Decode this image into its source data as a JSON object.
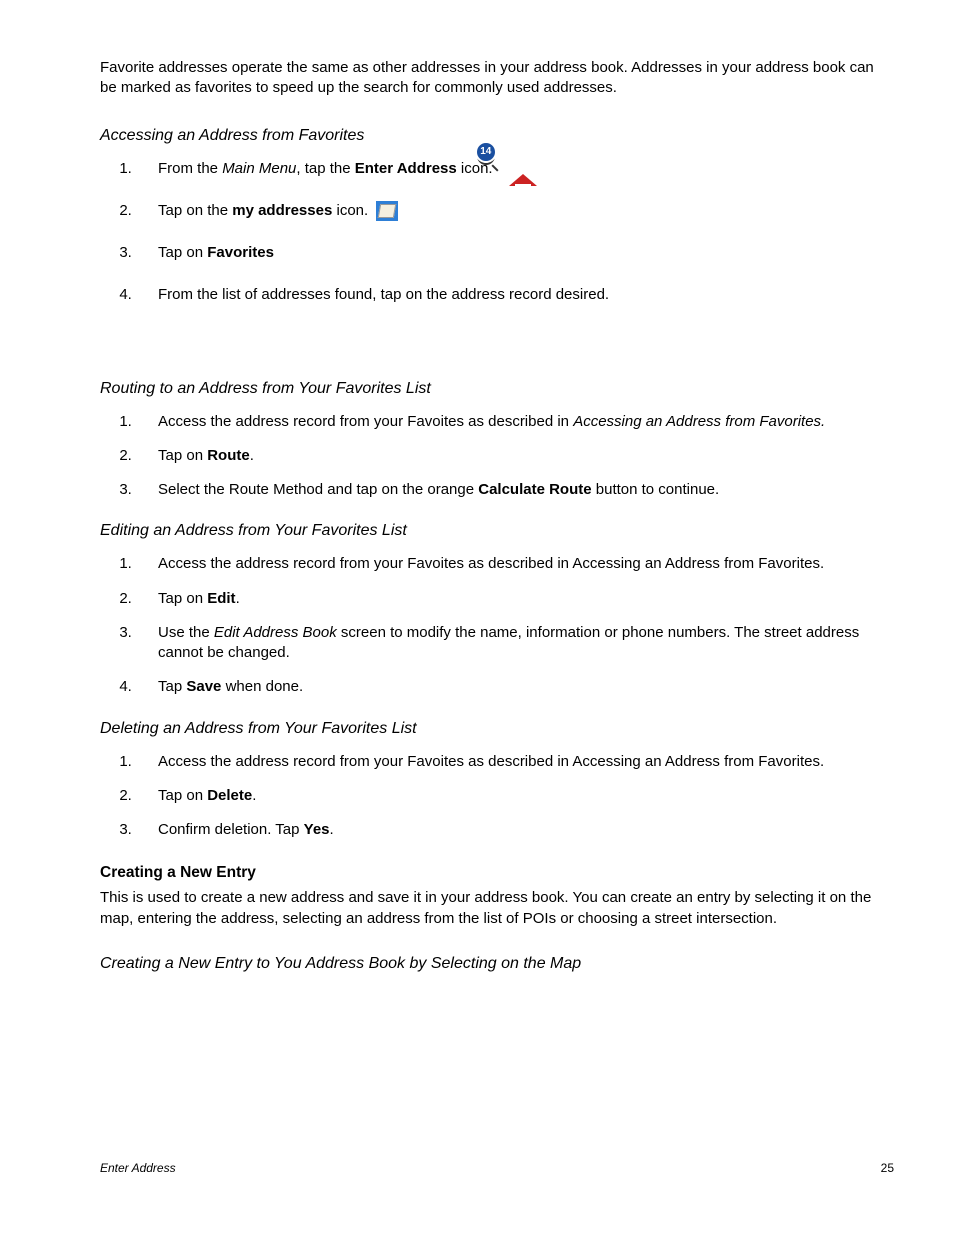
{
  "intro": {
    "t1": "Favorite addresses operate the same as other addresses in your address book.  Addresses in your address book can be marked as favorites to speed up the search for commonly used addresses."
  },
  "s1": {
    "title": "Accessing an Address from Favorites",
    "st1a": "From the ",
    "st1b": "Main Menu",
    "st1c": ", tap the ",
    "st1d": "Enter Address",
    "st1e": " icon.",
    "st2a": "Tap on the ",
    "st2b": "my addresses",
    "st2c": " icon.",
    "st3a": "Tap on ",
    "st3b": "Favorites",
    "st4": "From the list of addresses found, tap on the address record desired."
  },
  "s2": {
    "title": "Routing to an Address from Your Favorites List",
    "st1a": "Access the address record from your Favoites as described in ",
    "st1b": "Accessing an Address from Favorites.",
    "st2a": "Tap on ",
    "st2b": "Route",
    "st2c": ".",
    "st3a": "Select the Route Method and tap on the orange ",
    "st3b": "Calculate Route",
    "st3c": " button to continue."
  },
  "s3": {
    "title": "Editing an Address from Your Favorites List",
    "st1": "Access the address record from your Favoites as described in Accessing an Address from Favorites.",
    "st2a": "Tap on ",
    "st2b": "Edit",
    "st2c": ".",
    "st3a": "Use the ",
    "st3b": "Edit Address Book",
    "st3c": " screen to modify the name, information or phone numbers.  The street address cannot be changed.",
    "st4a": "Tap ",
    "st4b": "Save",
    "st4c": " when done."
  },
  "s4": {
    "title": "Deleting an Address from Your Favorites List",
    "st1": "Access the address record from your Favoites as described in Accessing an Address from Favorites.",
    "st2a": "Tap on ",
    "st2b": "Delete",
    "st2c": ".",
    "st3a": "Confirm deletion.  Tap ",
    "st3b": "Yes",
    "st3c": "."
  },
  "s5": {
    "title": "Creating a New Entry",
    "body": "This is used to create a new address and save it in your address book.  You can create an entry by selecting it on the map, entering the address, selecting an address from the list of POIs or choosing a street intersection."
  },
  "s6": {
    "title": "Creating a New Entry to You Address Book by Selecting on the Map"
  },
  "footer": {
    "left": "Enter Address",
    "right": "25"
  }
}
